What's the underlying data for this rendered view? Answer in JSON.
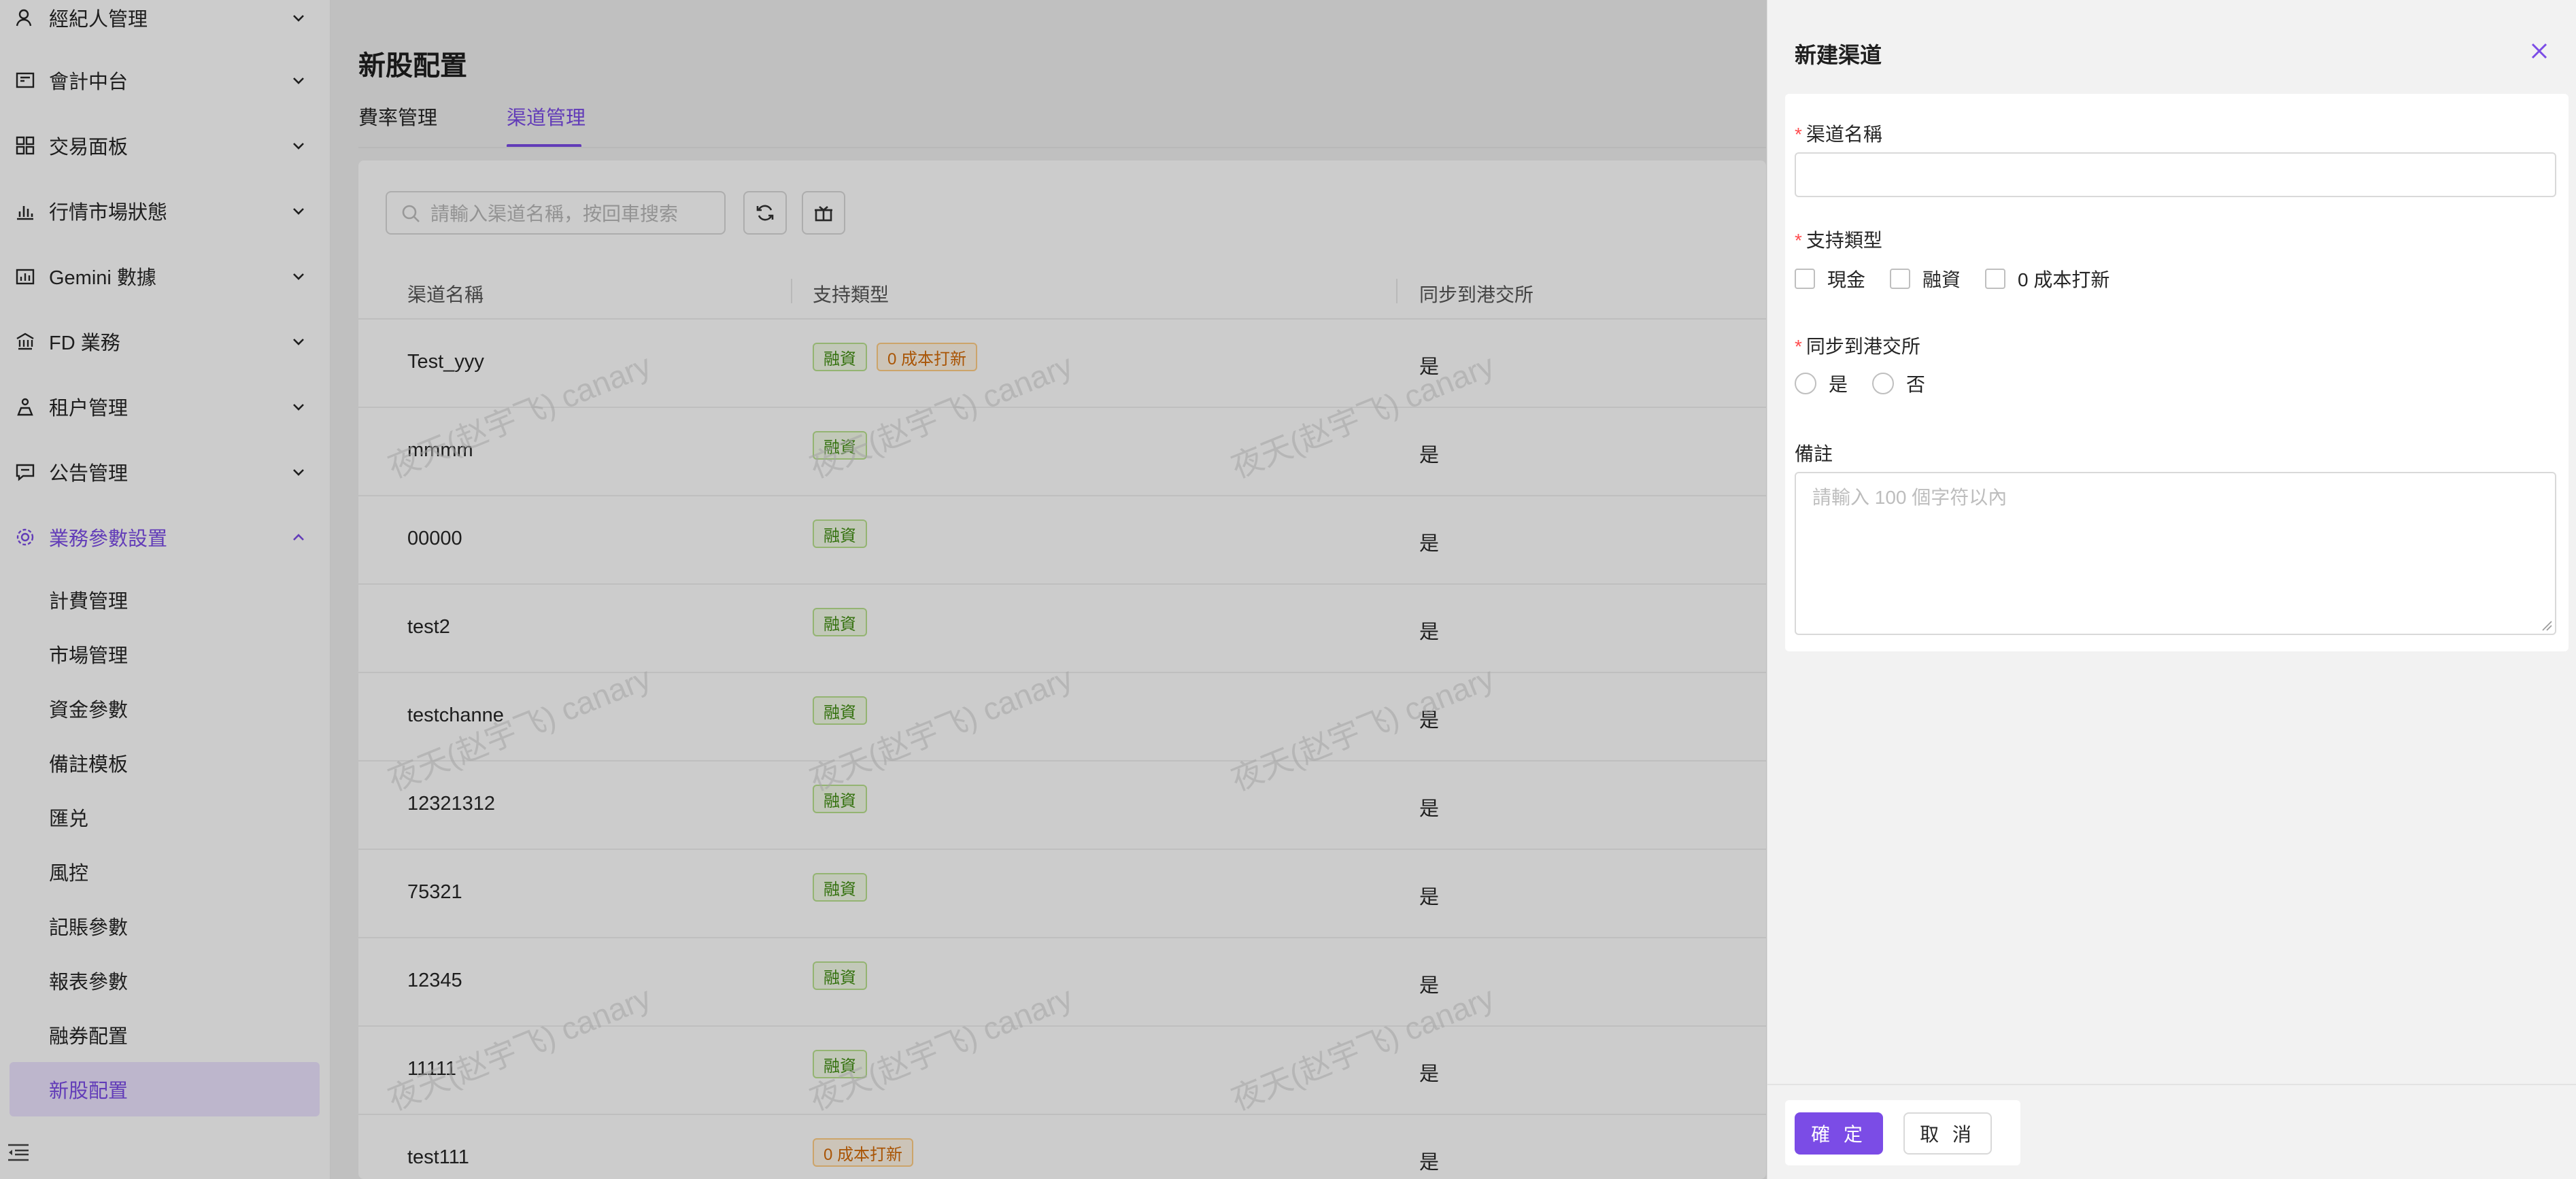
{
  "sidebar": {
    "menu": [
      {
        "label": "經紀人管理",
        "icon": "user-agent-icon"
      },
      {
        "label": "會計中台",
        "icon": "ledger-icon"
      },
      {
        "label": "交易面板",
        "icon": "dashboard-icon"
      },
      {
        "label": "行情市場狀態",
        "icon": "bar-chart-icon"
      },
      {
        "label": "Gemini 數據",
        "icon": "data-chart-icon"
      },
      {
        "label": "FD 業務",
        "icon": "bank-icon"
      },
      {
        "label": "租户管理",
        "icon": "tenant-icon"
      },
      {
        "label": "公告管理",
        "icon": "message-icon"
      },
      {
        "label": "業務參數設置",
        "icon": "settings-icon",
        "active": true
      }
    ],
    "submenu": [
      "計費管理",
      "市場管理",
      "資金參數",
      "備註模板",
      "匯兑",
      "風控",
      "記賬參數",
      "報表參數",
      "融券配置",
      "新股配置"
    ],
    "selected_submenu": "新股配置",
    "accent_color": "#7b4ce6"
  },
  "main": {
    "title": "新股配置",
    "tabs": [
      "費率管理",
      "渠道管理"
    ],
    "active_tab": "渠道管理",
    "search": {
      "placeholder": "請輸入渠道名稱，按回車搜索"
    },
    "table": {
      "columns": [
        "渠道名稱",
        "支持類型",
        "同步到港交所"
      ],
      "rows": [
        {
          "name": "Test_yyy",
          "tags": [
            "融資",
            "0 成本打新"
          ],
          "sync": "是"
        },
        {
          "name": "mmmm",
          "tags": [
            "融資"
          ],
          "sync": "是"
        },
        {
          "name": "00000",
          "tags": [
            "融資"
          ],
          "sync": "是"
        },
        {
          "name": "test2",
          "tags": [
            "融資"
          ],
          "sync": "是"
        },
        {
          "name": "testchanne",
          "tags": [
            "融資"
          ],
          "sync": "是"
        },
        {
          "name": "12321312",
          "tags": [
            "融資"
          ],
          "sync": "是"
        },
        {
          "name": "75321",
          "tags": [
            "融資"
          ],
          "sync": "是"
        },
        {
          "name": "12345",
          "tags": [
            "融資"
          ],
          "sync": "是"
        },
        {
          "name": "11111",
          "tags": [
            "融資"
          ],
          "sync": "是"
        },
        {
          "name": "test111",
          "tags": [
            "0 成本打新"
          ],
          "sync": "是"
        }
      ]
    },
    "watermark": "夜天(赵宇飞) canary"
  },
  "drawer": {
    "title": "新建渠道",
    "fields": {
      "channel_name": {
        "label": "渠道名稱",
        "value": ""
      },
      "support_type": {
        "label": "支持類型",
        "options": [
          "現金",
          "融資",
          "0 成本打新"
        ]
      },
      "sync_hkex": {
        "label": "同步到港交所",
        "options": [
          "是",
          "否"
        ]
      },
      "remark": {
        "label": "備註",
        "placeholder": "請輸入 100 個字符以內"
      }
    },
    "buttons": {
      "confirm": "確 定",
      "cancel": "取 消"
    }
  }
}
